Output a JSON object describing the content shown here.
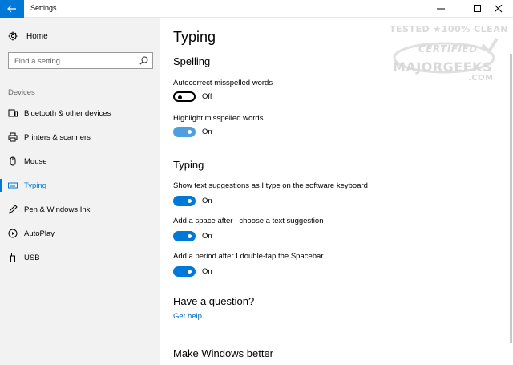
{
  "window": {
    "title": "Settings"
  },
  "sidebar": {
    "home_label": "Home",
    "search_placeholder": "Find a setting",
    "section_title": "Devices",
    "items": [
      {
        "label": "Bluetooth & other devices",
        "icon": "bluetooth-devices-icon"
      },
      {
        "label": "Printers & scanners",
        "icon": "printer-icon"
      },
      {
        "label": "Mouse",
        "icon": "mouse-icon"
      },
      {
        "label": "Typing",
        "icon": "keyboard-icon",
        "active": true
      },
      {
        "label": "Pen & Windows Ink",
        "icon": "pen-icon"
      },
      {
        "label": "AutoPlay",
        "icon": "autoplay-icon"
      },
      {
        "label": "USB",
        "icon": "usb-icon"
      }
    ]
  },
  "main": {
    "title": "Typing",
    "spelling": {
      "heading": "Spelling",
      "autocorrect_label": "Autocorrect misspelled words",
      "autocorrect_state": "Off",
      "highlight_label": "Highlight misspelled words",
      "highlight_state": "On"
    },
    "typing": {
      "heading": "Typing",
      "suggestions_label": "Show text suggestions as I type on the software keyboard",
      "suggestions_state": "On",
      "space_label": "Add a space after I choose a text suggestion",
      "space_state": "On",
      "period_label": "Add a period after I double-tap the Spacebar",
      "period_state": "On"
    },
    "question": {
      "heading": "Have a question?",
      "link": "Get help"
    },
    "better": {
      "heading": "Make Windows better"
    }
  },
  "watermark": {
    "line1": "TESTED ★100% CLEAN",
    "line2": "CERTIFIED",
    "line3": "MAJORGEEKS",
    "line4": ".COM"
  },
  "colors": {
    "accent": "#0078d7",
    "link": "#0067b8",
    "sidebar_bg": "#f2f2f2"
  }
}
